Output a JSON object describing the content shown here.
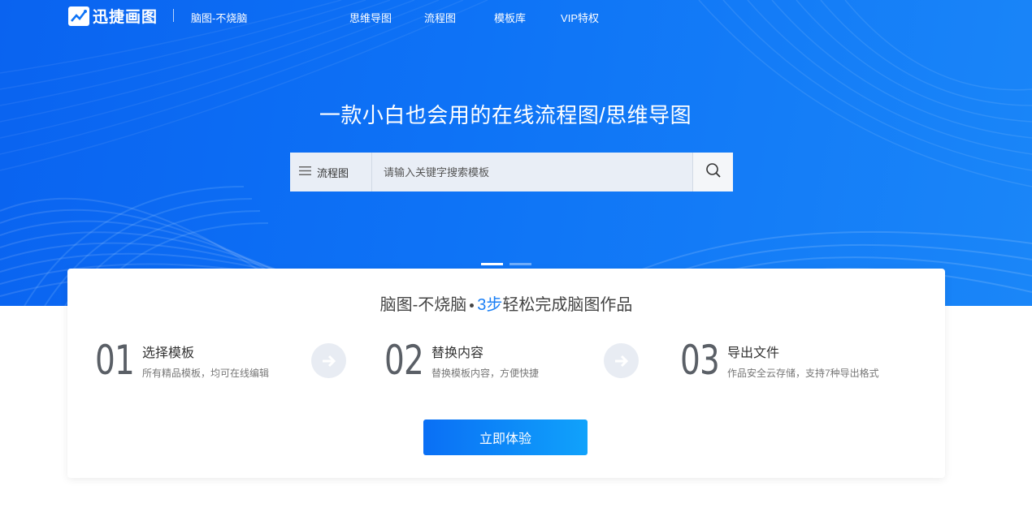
{
  "header": {
    "logo_text": "迅捷画图",
    "slogan": "脑图-不烧脑",
    "nav_links": [
      "思维导图",
      "流程图",
      "模板库",
      "VIP特权"
    ]
  },
  "hero": {
    "title": "一款小白也会用的在线流程图/思维导图",
    "search": {
      "type_label": "流程图",
      "placeholder": "请输入关键字搜索模板"
    },
    "carousel_count": 2,
    "carousel_active": 0
  },
  "card": {
    "title_prefix": "脑图-不烧脑",
    "title_number": "3步",
    "title_suffix": "轻松完成脑图作品",
    "steps": [
      {
        "num": "01",
        "title": "选择模板",
        "desc": "所有精品模板，均可在线编辑"
      },
      {
        "num": "02",
        "title": "替换内容",
        "desc": "替换模板内容，方便快捷"
      },
      {
        "num": "03",
        "title": "导出文件",
        "desc": "作品安全云存储，支持7种导出格式"
      }
    ],
    "cta_label": "立即体验"
  },
  "colors": {
    "brand_blue": "#0e73f6",
    "accent": "#1a7ff5"
  },
  "icons": [
    "logo-chart-icon",
    "menu-lines-icon",
    "search-icon",
    "arrow-right-icon"
  ]
}
